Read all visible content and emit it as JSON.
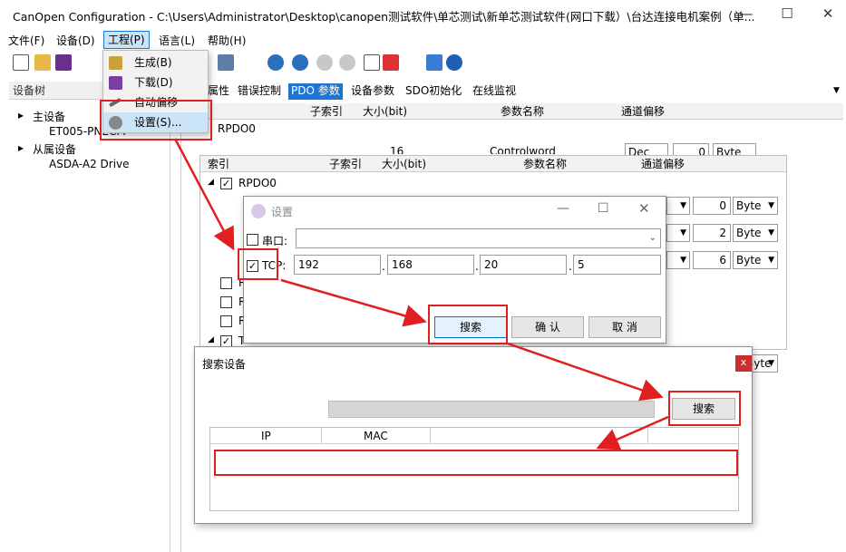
{
  "window": {
    "title": "CanOpen Configuration - C:\\Users\\Administrator\\Desktop\\canopen测试软件\\单芯测试\\新单芯测试软件(网口下载）\\台达连接电机案例（单...",
    "minimize": "—",
    "maximize": "☐",
    "close": "✕"
  },
  "menu": [
    "文件(F)",
    "设备(D)",
    "工程(P)",
    "语言(L)",
    "帮助(H)"
  ],
  "project_menu": {
    "items": [
      {
        "label": "生成(B)",
        "icon": "build-icon"
      },
      {
        "label": "下载(D)",
        "icon": "download-icon"
      },
      {
        "label": "自动偏移",
        "icon": "auto-offset-icon"
      },
      {
        "label": "设置(S)...",
        "icon": "gear-icon"
      }
    ],
    "selected": "设置(S)..."
  },
  "left_pane": {
    "header": "设备树",
    "tree": [
      {
        "label": "主设备",
        "level": 0,
        "expander": "▸"
      },
      {
        "label": "ET005-PNECM",
        "level": 1
      },
      {
        "label": "从属设备",
        "level": 0,
        "expander": "▸"
      },
      {
        "label": "ASDA-A2 Drive",
        "level": 1
      }
    ]
  },
  "tabs": [
    "属性",
    "错误控制",
    "PDO 参数",
    "设备参数",
    "SDO初始化",
    "在线监视"
  ],
  "active_tab": "PDO 参数",
  "pdo_grid": {
    "headers": [
      "子索引",
      "大小(bit)",
      "参数名称",
      "通道偏移"
    ],
    "rpdo_label": "RPDO0",
    "row": {
      "index": "0",
      "size": "16",
      "name": "Controlword",
      "type": "Dec",
      "offset": "0",
      "unit": "Byte"
    }
  },
  "pdo_grid2": {
    "headers": [
      "索引",
      "子索引",
      "大小(bit)",
      "参数名称",
      "通道偏移"
    ],
    "rpdo_label": "RPDO0",
    "offsets": [
      {
        "value": "0",
        "unit": "Byte"
      },
      {
        "value": "2",
        "unit": "Byte"
      },
      {
        "value": "6",
        "unit": "Byte"
      }
    ],
    "row_prefix": "R",
    "tpdo_prefix": "T",
    "extra_unit": "Byte"
  },
  "settings_dialog": {
    "title": "设置",
    "serial_label": "串口:",
    "serial_value": "",
    "tcp_label": "TCP:",
    "tcp_checked": "✓",
    "ip": [
      "192",
      "168",
      "20",
      "5"
    ],
    "buttons": {
      "search": "搜索",
      "ok": "确 认",
      "cancel": "取 消"
    }
  },
  "search_dialog": {
    "title": "搜索设备",
    "close": "x",
    "search_button": "搜索",
    "table_headers": [
      "IP",
      "MAC"
    ]
  },
  "colors": {
    "accent": "#1f76d2",
    "annotation": "#e02020"
  }
}
